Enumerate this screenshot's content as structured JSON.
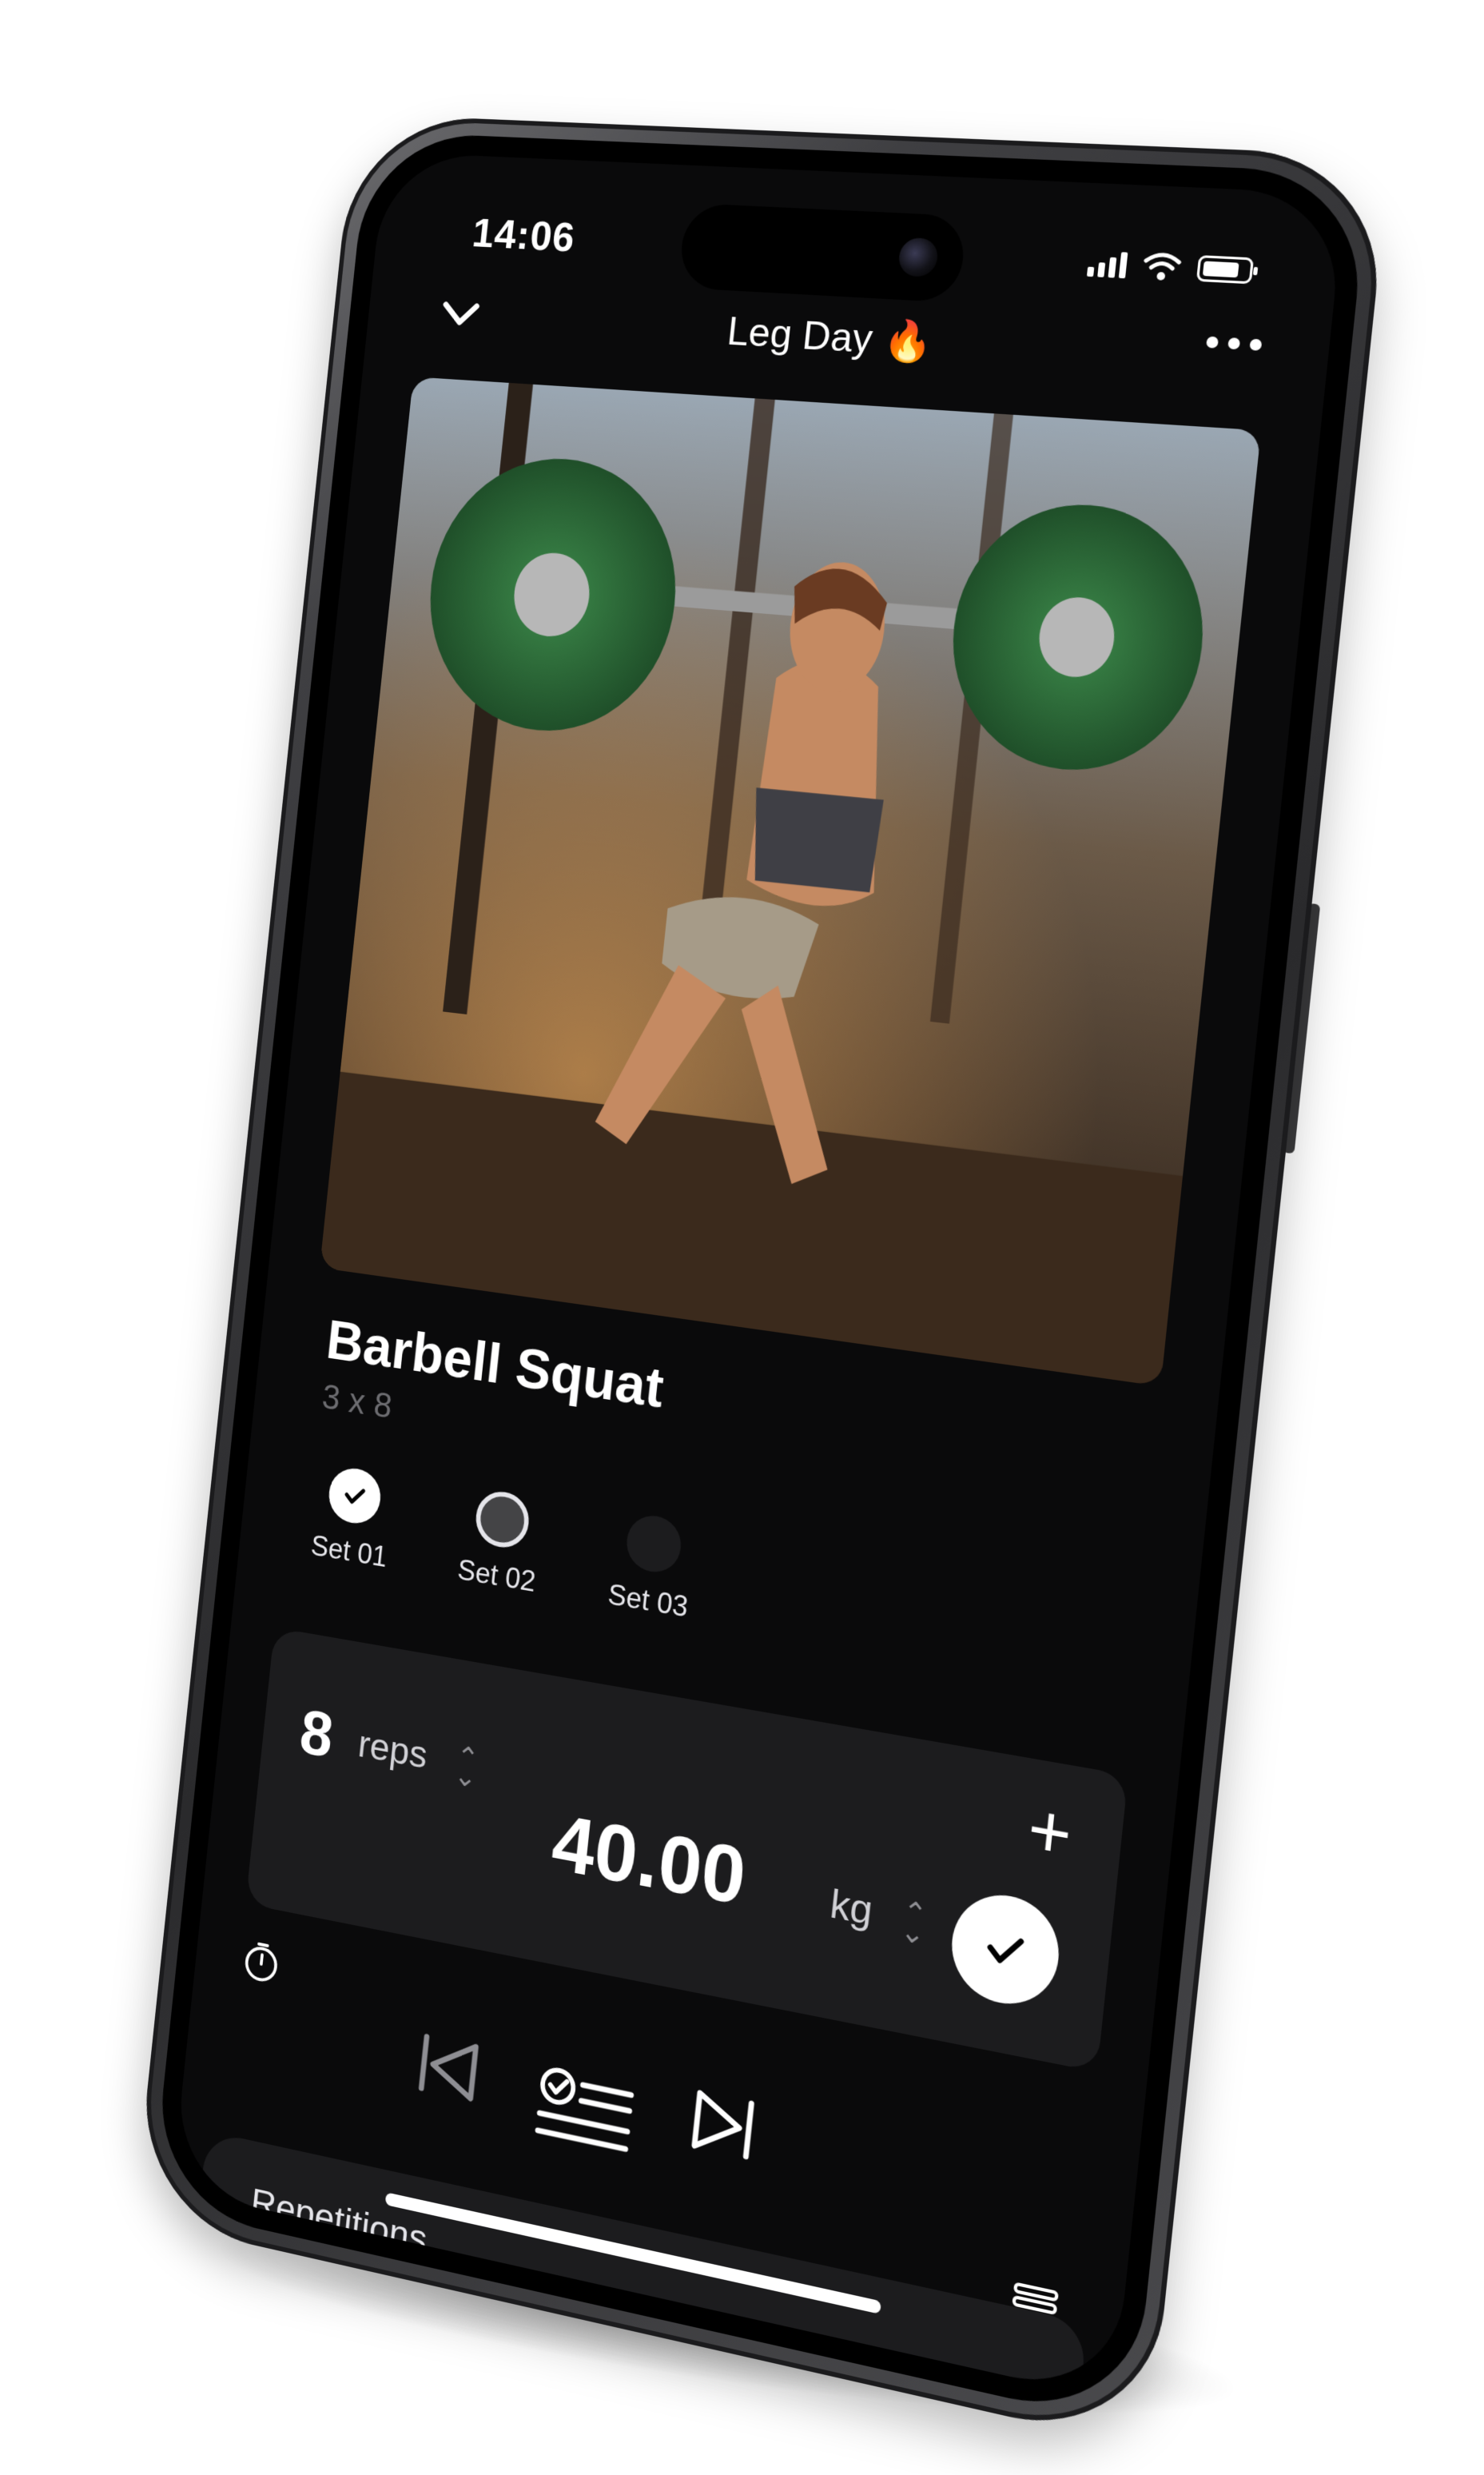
{
  "status_bar": {
    "time": "14:06"
  },
  "nav": {
    "title": "Leg Day 🔥"
  },
  "exercise": {
    "name": "Barbell Squat",
    "scheme": "3 x 8"
  },
  "sets": [
    {
      "label": "Set 01",
      "state": "done"
    },
    {
      "label": "Set 02",
      "state": "current"
    },
    {
      "label": "Set 03",
      "state": "todo"
    }
  ],
  "entry": {
    "reps_value": "8",
    "reps_unit": "reps",
    "weight_value": "40.00",
    "weight_unit": "kg",
    "add_symbol": "+"
  },
  "sheet": {
    "heading": "Repetitions"
  },
  "icons": {
    "back": "chevron-down-icon",
    "more": "more-icon",
    "timer": "stopwatch-icon",
    "prev": "skip-previous-icon",
    "list": "checklist-icon",
    "next": "skip-next-icon",
    "stack": "stack-icon"
  },
  "colors": {
    "screen_bg": "#0a0a0b",
    "card_bg": "#1c1c1e",
    "plate_green": "#2f6b3a",
    "muted_text": "#6c6c70"
  }
}
